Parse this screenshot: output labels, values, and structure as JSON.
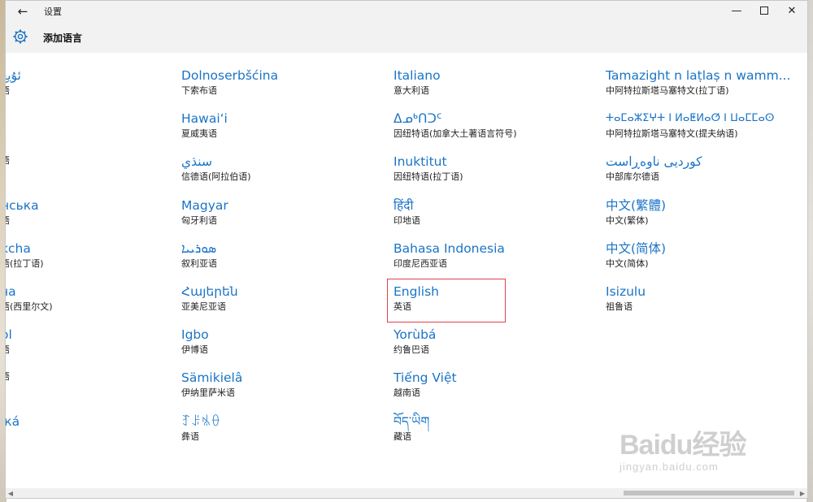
{
  "window": {
    "title": "设置",
    "page_title": "添加语言"
  },
  "languages": {
    "col0": [
      {
        "name": "ئۇيغ",
        "sub": "语"
      },
      {
        "name": "",
        "sub": ""
      },
      {
        "name": "",
        "sub": "语"
      },
      {
        "name": "нська",
        "sub": "语"
      },
      {
        "name": "kcha",
        "sub": "语(拉丁语)"
      },
      {
        "name": "ча",
        "sub": "语(西里尔文)"
      },
      {
        "name": "ol",
        "sub": "语"
      },
      {
        "name": "",
        "sub": "语"
      },
      {
        "name": "іка́",
        "sub": ""
      }
    ],
    "col1": [
      {
        "name": "Dolnoserbšćina",
        "sub": "下索布语"
      },
      {
        "name": "Hawaiʻi",
        "sub": "夏威夷语"
      },
      {
        "name": "سنڌي",
        "sub": "信德语(阿拉伯语)"
      },
      {
        "name": "Magyar",
        "sub": "匈牙利语"
      },
      {
        "name": "ܣܘܪܝܝܐ",
        "sub": "叙利亚语"
      },
      {
        "name": "Հայերեն",
        "sub": "亚美尼亚语"
      },
      {
        "name": "Igbo",
        "sub": "伊博语"
      },
      {
        "name": "Sämikielâ",
        "sub": "伊纳里萨米语"
      },
      {
        "name": "ꆈꌠꁱꂷ",
        "sub": "彝语"
      }
    ],
    "col2": [
      {
        "name": "Italiano",
        "sub": "意大利语"
      },
      {
        "name": "ᐃᓄᒃᑎᑐᑦ",
        "sub": "因纽特语(加拿大土著语言符号)"
      },
      {
        "name": "Inuktitut",
        "sub": "因纽特语(拉丁语)"
      },
      {
        "name": "हिंदी",
        "sub": "印地语"
      },
      {
        "name": "Bahasa Indonesia",
        "sub": "印度尼西亚语"
      },
      {
        "name": "English",
        "sub": "英语"
      },
      {
        "name": "Yorùbá",
        "sub": "约鲁巴语"
      },
      {
        "name": "Tiếng Việt",
        "sub": "越南语"
      },
      {
        "name": "བོད་ཡིག",
        "sub": "藏语"
      }
    ],
    "col3": [
      {
        "name": "Tamazight n laṭlaṣ n wamm...",
        "sub": "中阿特拉斯塔马塞特文(拉丁语)"
      },
      {
        "name": "ⵜⴰⵎⴰⵣⵉⵖⵜ ⵏ ⵍⴰⵟⵍⴰⵚ ⵏ ⵡⴰⵎⵎⴰⵙ",
        "sub": "中阿特拉斯塔马塞特文(提夫纳语)"
      },
      {
        "name": "کوردیی ناوەڕاست",
        "sub": "中部库尔德语"
      },
      {
        "name": "中文(繁體)",
        "sub": "中文(繁体)"
      },
      {
        "name": "中文(简体)",
        "sub": "中文(简体)"
      },
      {
        "name": "Isizulu",
        "sub": "祖鲁语"
      }
    ]
  },
  "watermark": {
    "logo": "Baidu经验",
    "url": "jingyan.baidu.com"
  },
  "colors": {
    "accent": "#1a74c6",
    "selection": "#e0424a"
  },
  "icons": [
    "back-arrow-icon",
    "minimize-icon",
    "maximize-icon",
    "close-icon",
    "gear-icon"
  ]
}
